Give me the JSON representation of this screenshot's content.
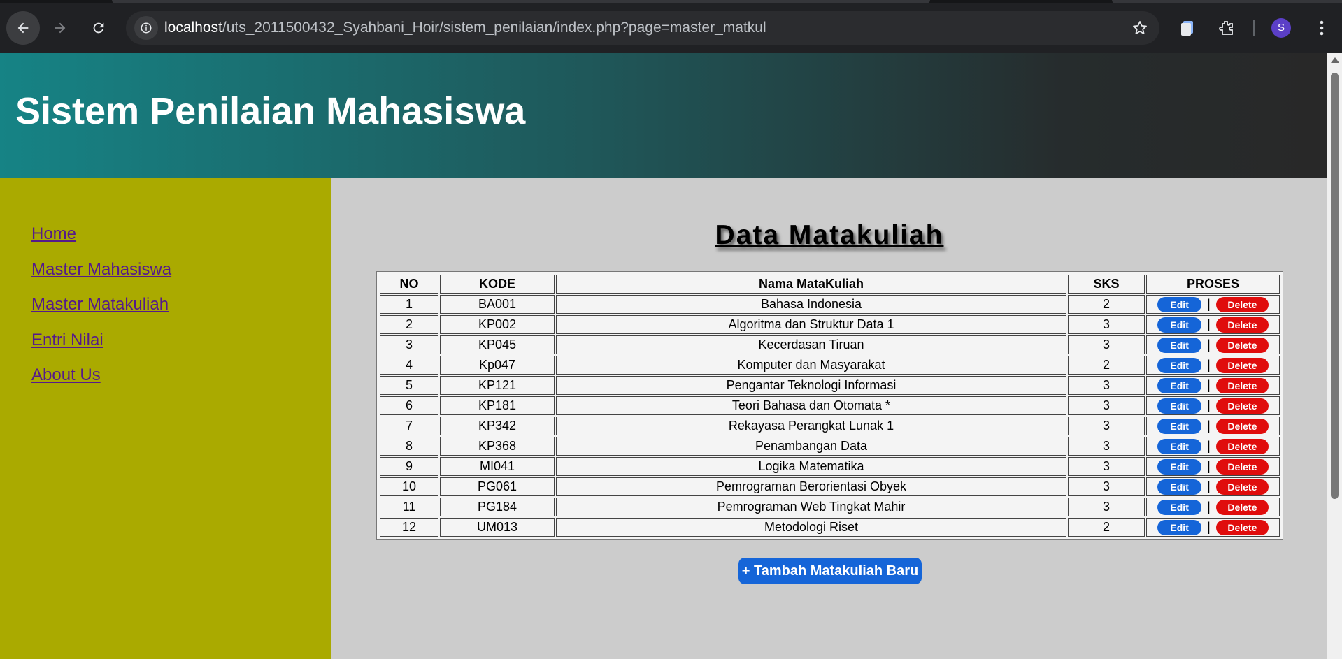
{
  "browser": {
    "url_host": "localhost",
    "url_path": "/uts_2011500432_Syahbani_Hoir/sistem_penilaian/index.php?page=master_matkul",
    "profile_initial": "S"
  },
  "header": {
    "title": "Sistem Penilaian Mahasiswa"
  },
  "sidebar": {
    "items": [
      {
        "label": "Home"
      },
      {
        "label": "Master Mahasiswa"
      },
      {
        "label": "Master Matakuliah"
      },
      {
        "label": "Entri Nilai"
      },
      {
        "label": "About Us"
      }
    ]
  },
  "main": {
    "title": "Data Matakuliah",
    "columns": [
      "NO",
      "KODE",
      "Nama MataKuliah",
      "SKS",
      "PROSES"
    ],
    "rows": [
      {
        "no": "1",
        "kode": "BA001",
        "nama": "Bahasa Indonesia",
        "sks": "2"
      },
      {
        "no": "2",
        "kode": "KP002",
        "nama": "Algoritma dan Struktur Data 1",
        "sks": "3"
      },
      {
        "no": "3",
        "kode": "KP045",
        "nama": "Kecerdasan Tiruan",
        "sks": "3"
      },
      {
        "no": "4",
        "kode": "Kp047",
        "nama": "Komputer dan Masyarakat",
        "sks": "2"
      },
      {
        "no": "5",
        "kode": "KP121",
        "nama": "Pengantar Teknologi Informasi",
        "sks": "3"
      },
      {
        "no": "6",
        "kode": "KP181",
        "nama": "Teori Bahasa dan Otomata *",
        "sks": "3"
      },
      {
        "no": "7",
        "kode": "KP342",
        "nama": "Rekayasa Perangkat Lunak 1",
        "sks": "3"
      },
      {
        "no": "8",
        "kode": "KP368",
        "nama": "Penambangan Data",
        "sks": "3"
      },
      {
        "no": "9",
        "kode": "MI041",
        "nama": "Logika Matematika",
        "sks": "3"
      },
      {
        "no": "10",
        "kode": "PG061",
        "nama": "Pemrograman Berorientasi Obyek",
        "sks": "3"
      },
      {
        "no": "11",
        "kode": "PG184",
        "nama": "Pemrograman Web Tingkat Mahir",
        "sks": "3"
      },
      {
        "no": "12",
        "kode": "UM013",
        "nama": "Metodologi Riset",
        "sks": "2"
      }
    ],
    "edit_label": "Edit",
    "delete_label": "Delete",
    "separator": "|",
    "add_button": "+ Tambah Matakuliah Baru"
  },
  "colors": {
    "sidebar_bg": "#aaaa00",
    "edit_button": "#1565d8",
    "delete_button": "#e00d0d",
    "link": "#551a8b"
  }
}
